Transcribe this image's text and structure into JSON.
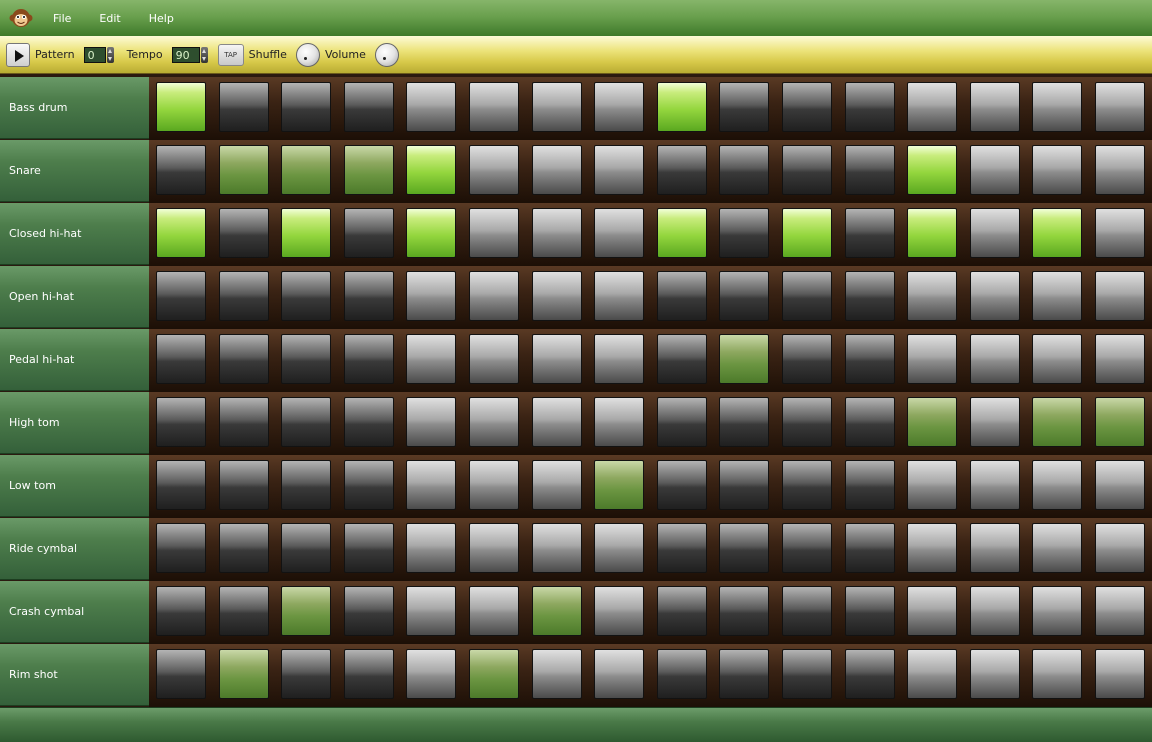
{
  "menu": {
    "items": [
      "File",
      "Edit",
      "Help"
    ]
  },
  "toolbar": {
    "pattern_label": "Pattern",
    "pattern_value": "0",
    "tempo_label": "Tempo",
    "tempo_value": "90",
    "tap_label": "TAP",
    "shuffle_label": "Shuffle",
    "volume_label": "Volume"
  },
  "colors": {
    "step_on": "#94d63e",
    "label_bg": "#4e7e4c",
    "toolbar": "#ece37a"
  },
  "tracks": [
    {
      "name": "Bass drum",
      "steps": [
        2,
        0,
        0,
        0,
        0,
        0,
        0,
        0,
        2,
        0,
        0,
        0,
        0,
        0,
        0,
        0
      ]
    },
    {
      "name": "Snare",
      "steps": [
        0,
        1,
        1,
        1,
        2,
        0,
        0,
        0,
        0,
        0,
        0,
        0,
        2,
        0,
        0,
        0
      ]
    },
    {
      "name": "Closed hi-hat",
      "steps": [
        2,
        0,
        2,
        0,
        2,
        0,
        0,
        0,
        2,
        0,
        2,
        0,
        2,
        0,
        2,
        0
      ]
    },
    {
      "name": "Open hi-hat",
      "steps": [
        0,
        0,
        0,
        0,
        0,
        0,
        0,
        0,
        0,
        0,
        0,
        0,
        0,
        0,
        0,
        0
      ]
    },
    {
      "name": "Pedal hi-hat",
      "steps": [
        0,
        0,
        0,
        0,
        0,
        0,
        0,
        0,
        0,
        1,
        0,
        0,
        0,
        0,
        0,
        0
      ]
    },
    {
      "name": "High tom",
      "steps": [
        0,
        0,
        0,
        0,
        0,
        0,
        0,
        0,
        0,
        0,
        0,
        0,
        1,
        0,
        1,
        1
      ]
    },
    {
      "name": "Low tom",
      "steps": [
        0,
        0,
        0,
        0,
        0,
        0,
        0,
        1,
        0,
        0,
        0,
        0,
        0,
        0,
        0,
        0
      ]
    },
    {
      "name": "Ride cymbal",
      "steps": [
        0,
        0,
        0,
        0,
        0,
        0,
        0,
        0,
        0,
        0,
        0,
        0,
        0,
        0,
        0,
        0
      ]
    },
    {
      "name": "Crash cymbal",
      "steps": [
        0,
        0,
        1,
        0,
        0,
        0,
        1,
        0,
        0,
        0,
        0,
        0,
        0,
        0,
        0,
        0
      ]
    },
    {
      "name": "Rim shot",
      "steps": [
        0,
        1,
        0,
        0,
        0,
        1,
        0,
        0,
        0,
        0,
        0,
        0,
        0,
        0,
        0,
        0
      ]
    }
  ]
}
